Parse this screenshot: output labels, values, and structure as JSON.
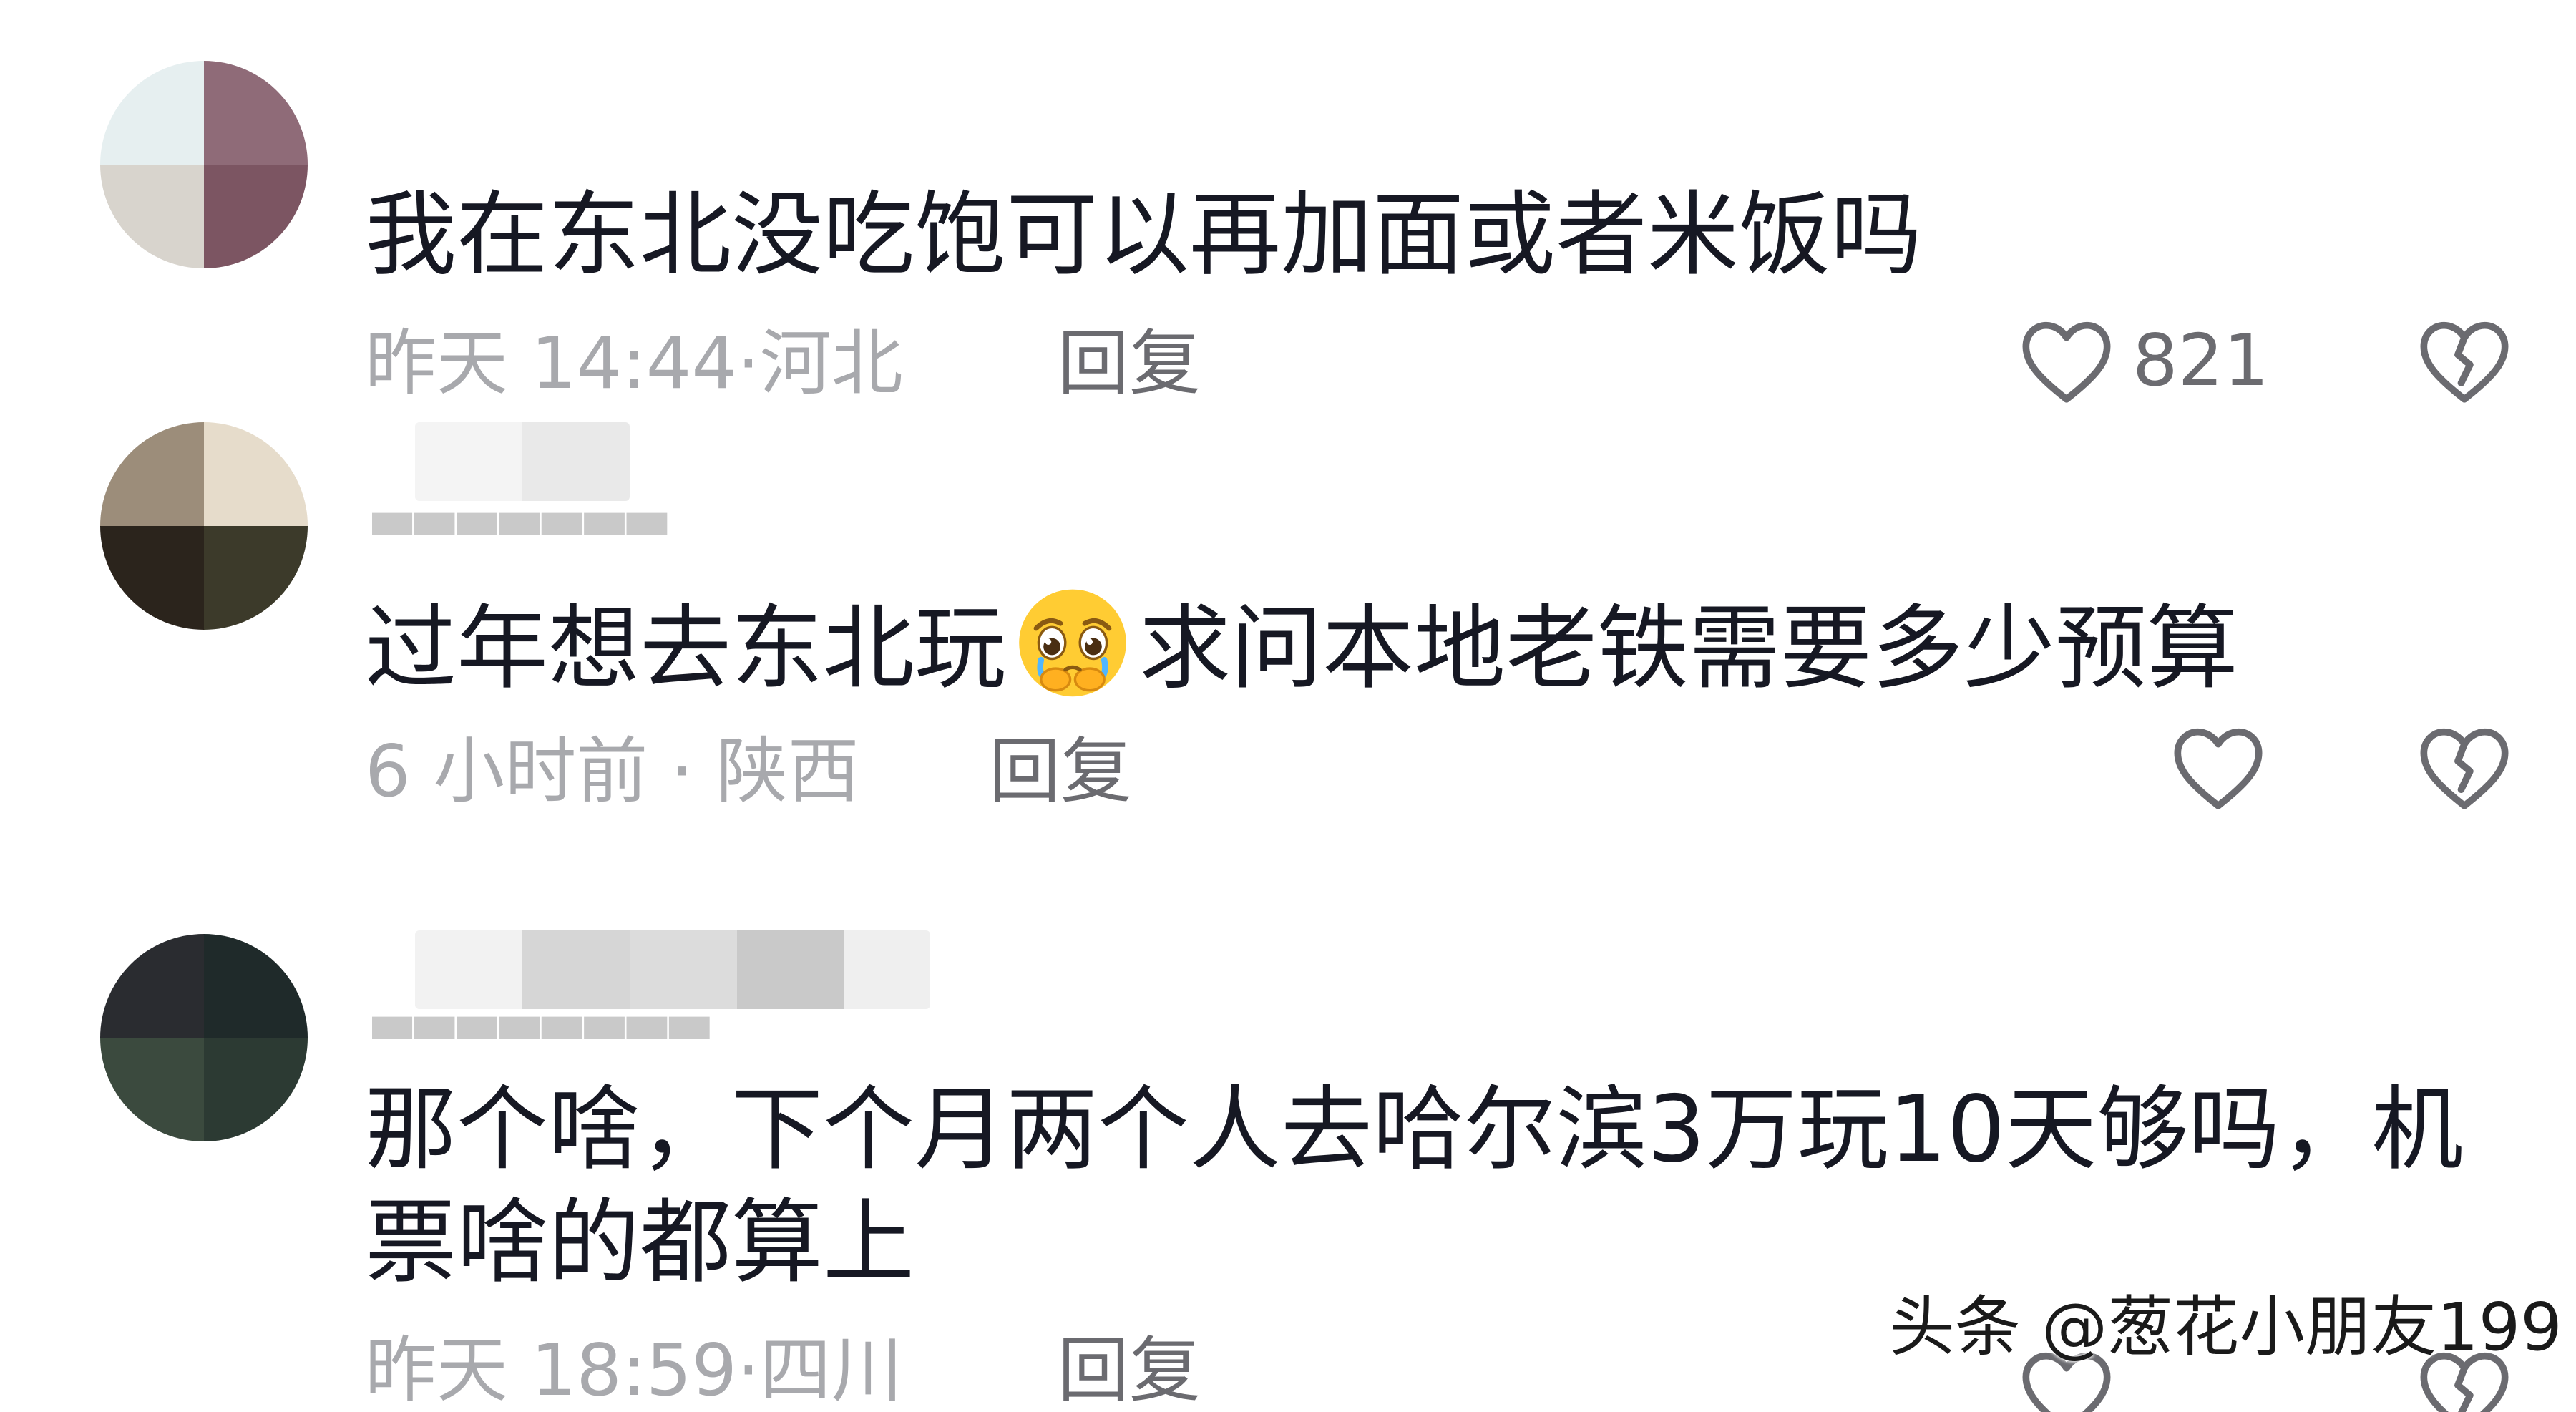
{
  "comments": [
    {
      "text": "我在东北没吃饱可以再加面或者米饭吗",
      "time": "昨天 14:44",
      "region": "河北",
      "reply_label": "回复",
      "likes": "821"
    },
    {
      "text_before_emoji": "过年想去东北玩",
      "emoji": "pleading-face-emoji",
      "text_after_emoji": "求问本地老铁需要多少预算",
      "time": "6 小时前",
      "region": "陕西",
      "reply_label": "回复"
    },
    {
      "text": "那个啥，下个月两个人去哈尔滨3万玩10天够吗，机票啥的都算上",
      "time": "昨天 18:59",
      "region": "四川",
      "reply_label": "回复"
    }
  ],
  "separator": "·",
  "watermark": "头条 @葱花小朋友199",
  "colors": {
    "text": "#161823",
    "meta": "#a8a9ad",
    "reply": "#6b6b70",
    "icon": "#6b6b70"
  }
}
